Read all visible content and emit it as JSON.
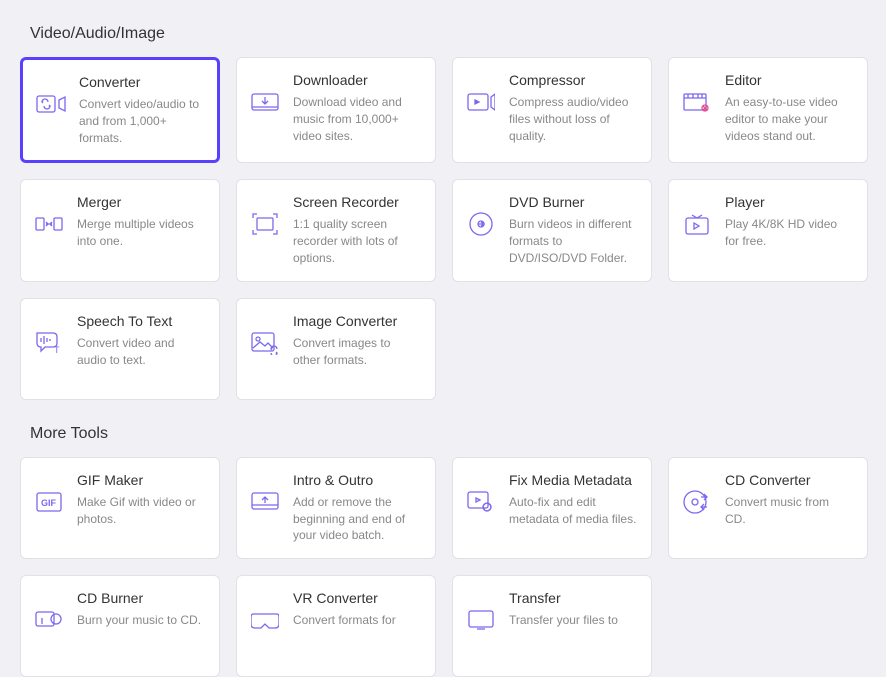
{
  "sections": {
    "video_audio_image": {
      "title": "Video/Audio/Image",
      "tools": [
        {
          "name": "Converter",
          "desc": "Convert video/audio to and from 1,000+ formats."
        },
        {
          "name": "Downloader",
          "desc": "Download video and music from 10,000+ video sites."
        },
        {
          "name": "Compressor",
          "desc": "Compress audio/video files without loss of quality."
        },
        {
          "name": "Editor",
          "desc": "An easy-to-use video editor to make your videos stand out."
        },
        {
          "name": "Merger",
          "desc": "Merge multiple videos into one."
        },
        {
          "name": "Screen Recorder",
          "desc": "1:1 quality screen recorder with lots of options."
        },
        {
          "name": "DVD Burner",
          "desc": "Burn videos in different formats to DVD/ISO/DVD Folder."
        },
        {
          "name": "Player",
          "desc": "Play 4K/8K HD video for free."
        },
        {
          "name": "Speech To Text",
          "desc": "Convert video and audio to text."
        },
        {
          "name": "Image Converter",
          "desc": "Convert images to other formats."
        }
      ]
    },
    "more_tools": {
      "title": "More Tools",
      "tools": [
        {
          "name": "GIF Maker",
          "desc": "Make Gif with video or photos."
        },
        {
          "name": "Intro & Outro",
          "desc": "Add or remove the beginning and end of your video batch."
        },
        {
          "name": "Fix Media Metadata",
          "desc": "Auto-fix and edit metadata of media files."
        },
        {
          "name": "CD Converter",
          "desc": "Convert music from CD."
        },
        {
          "name": "CD Burner",
          "desc": "Burn your music to CD."
        },
        {
          "name": "VR Converter",
          "desc": "Convert formats for"
        },
        {
          "name": "Transfer",
          "desc": "Transfer your files to"
        }
      ]
    }
  }
}
